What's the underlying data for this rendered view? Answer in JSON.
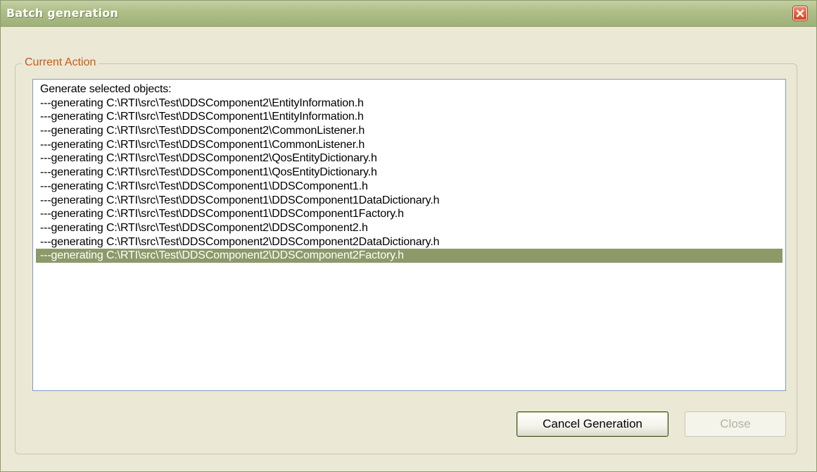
{
  "window": {
    "title": "Batch generation"
  },
  "group": {
    "label": "Current Action"
  },
  "log": {
    "lines": [
      "Generate selected objects:",
      "---generating C:\\RTI\\src\\Test\\DDSComponent2\\EntityInformation.h",
      "---generating C:\\RTI\\src\\Test\\DDSComponent1\\EntityInformation.h",
      "---generating C:\\RTI\\src\\Test\\DDSComponent2\\CommonListener.h",
      "---generating C:\\RTI\\src\\Test\\DDSComponent1\\CommonListener.h",
      "---generating C:\\RTI\\src\\Test\\DDSComponent2\\QosEntityDictionary.h",
      "---generating C:\\RTI\\src\\Test\\DDSComponent1\\QosEntityDictionary.h",
      "---generating C:\\RTI\\src\\Test\\DDSComponent1\\DDSComponent1.h",
      "---generating C:\\RTI\\src\\Test\\DDSComponent1\\DDSComponent1DataDictionary.h",
      "---generating C:\\RTI\\src\\Test\\DDSComponent1\\DDSComponent1Factory.h",
      "---generating C:\\RTI\\src\\Test\\DDSComponent2\\DDSComponent2.h",
      "---generating C:\\RTI\\src\\Test\\DDSComponent2\\DDSComponent2DataDictionary.h",
      "---generating C:\\RTI\\src\\Test\\DDSComponent2\\DDSComponent2Factory.h"
    ],
    "selected_index": 12
  },
  "buttons": {
    "cancel_label": "Cancel Generation",
    "close_label": "Close"
  },
  "colors": {
    "titlebar": "#adbd86",
    "selection": "#8c9a6a",
    "group_label": "#c35d18",
    "close_red": "#d4421d"
  },
  "icons": {
    "close": "close-icon"
  }
}
